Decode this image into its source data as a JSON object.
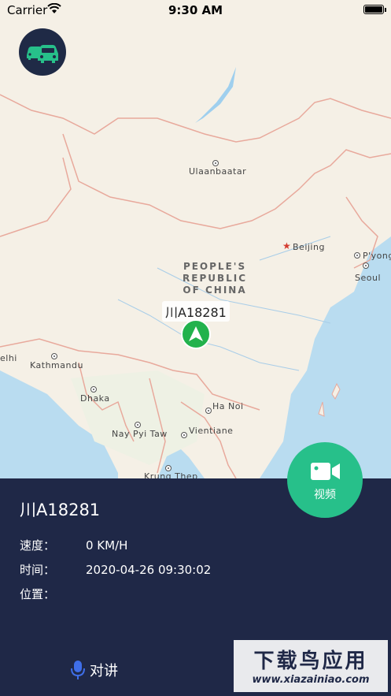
{
  "status_bar": {
    "carrier": "Carrier",
    "time": "9:30 AM"
  },
  "map": {
    "cities": [
      {
        "name": "Ulaanbaatar",
        "type": "city"
      },
      {
        "name": "Beijing",
        "type": "capital"
      },
      {
        "name": "P'yong",
        "type": "city"
      },
      {
        "name": "Seoul",
        "type": "city"
      },
      {
        "name": "elhi",
        "type": "city"
      },
      {
        "name": "Kathmandu",
        "type": "city"
      },
      {
        "name": "Dhaka",
        "type": "city"
      },
      {
        "name": "Ha Noi",
        "type": "city"
      },
      {
        "name": "Nay Pyi Taw",
        "type": "city"
      },
      {
        "name": "Vientiane",
        "type": "city"
      },
      {
        "name": "Krung Thep",
        "type": "city"
      }
    ],
    "country_label": [
      "PEOPLE'S",
      "REPUBLIC",
      "OF CHINA"
    ]
  },
  "vehicle": {
    "plate": "川A18281"
  },
  "video_button": {
    "label": "视频",
    "color": "#27c08a"
  },
  "details": {
    "plate": "川A18281",
    "rows": [
      {
        "key": "速度：",
        "value": "0 KM/H"
      },
      {
        "key": "时间：",
        "value": "2020-04-26 09:30:02"
      },
      {
        "key": "位置：",
        "value": ""
      }
    ]
  },
  "talk_button": {
    "label": "对讲"
  },
  "watermark": {
    "title": "下载鸟应用",
    "url": "www.xiazainiao.com"
  },
  "colors": {
    "panel": "#1f2847",
    "accent": "#27c08a",
    "marker": "#22b24c"
  }
}
